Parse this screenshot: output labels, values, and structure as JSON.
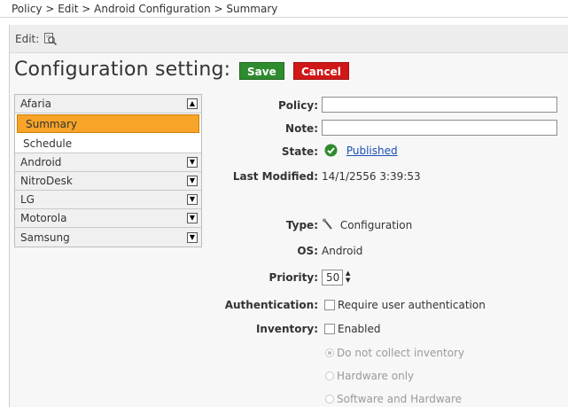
{
  "breadcrumb": "Policy > Edit > Android Configuration > Summary",
  "editbar": {
    "label": "Edit:",
    "icon": "preview-icon"
  },
  "heading": "Configuration setting:",
  "buttons": {
    "save": "Save",
    "cancel": "Cancel"
  },
  "sidebar": {
    "groups": [
      {
        "label": "Afaria",
        "expanded": true
      },
      {
        "label": "Android"
      },
      {
        "label": "NitroDesk"
      },
      {
        "label": "LG"
      },
      {
        "label": "Motorola"
      },
      {
        "label": "Samsung"
      }
    ],
    "subitems": [
      "Summary",
      "Schedule"
    ]
  },
  "form": {
    "policy_label": "Policy:",
    "policy_value": "",
    "note_label": "Note:",
    "note_value": "",
    "state_label": "State:",
    "state_value": "Published",
    "last_modified_label": "Last Modified:",
    "last_modified_value": "14/1/2556 3:39:53",
    "type_label": "Type:",
    "type_value": "Configuration",
    "os_label": "OS:",
    "os_value": "Android",
    "priority_label": "Priority:",
    "priority_value": "50",
    "auth_label": "Authentication:",
    "auth_option": "Require user authentication",
    "inventory_label": "Inventory:",
    "inventory_option": "Enabled",
    "inventory_radios": [
      "Do not collect inventory",
      "Hardware only",
      "Software and Hardware"
    ]
  },
  "colors": {
    "save": "#2e8b2e",
    "cancel": "#d01818",
    "active_item": "#f7a428",
    "link": "#1a4fb5",
    "published": "#2e8b2e"
  }
}
